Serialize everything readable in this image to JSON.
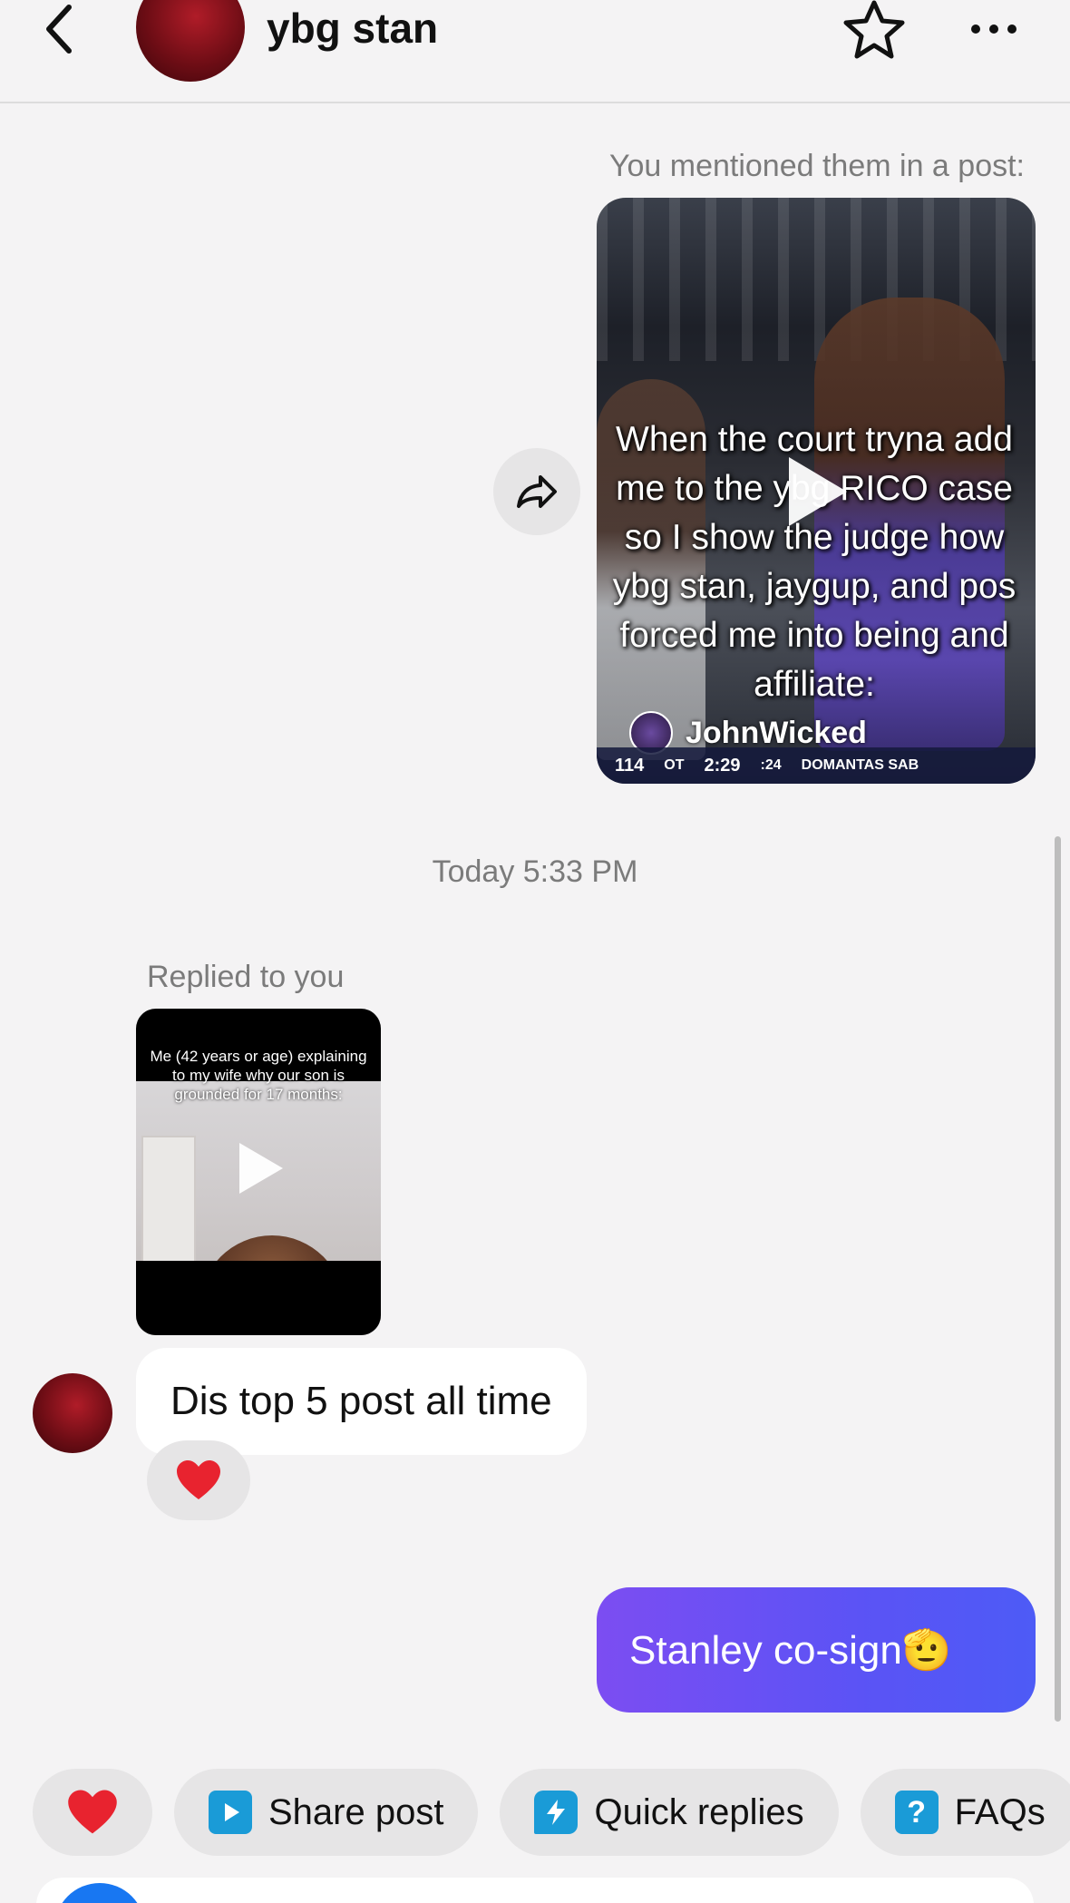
{
  "header": {
    "title": "ybg stan"
  },
  "shared_post": {
    "label": "You mentioned them in a post:",
    "caption": "When the court tryna add\nme to the ybg RICO case\nso I show the judge how\nybg stan, jaygup, and pos\nforced me into being and\naffiliate:",
    "username": "JohnWicked",
    "scoreboard": {
      "score": "114",
      "period": "OT",
      "clock": "2:29",
      "shot_clock": ":24",
      "ticker": "DOMANTAS SAB"
    }
  },
  "timestamp": "Today 5:33 PM",
  "reply": {
    "label": "Replied to you",
    "thumb_caption": "Me (42 years or age) explaining to my wife why our son is grounded for 17 months:",
    "message": "Dis top 5 post all time",
    "reaction": "❤️"
  },
  "outgoing": {
    "message": "Stanley co-sign🫡"
  },
  "quick_actions": [
    {
      "label": "❤️"
    },
    {
      "label": "Share post"
    },
    {
      "label": "Quick replies"
    },
    {
      "label": "FAQs"
    }
  ],
  "colors": {
    "outgoing_bubble": "#5b53f5",
    "background": "#f4f3f4",
    "share_icon": "#1a9bd7"
  }
}
